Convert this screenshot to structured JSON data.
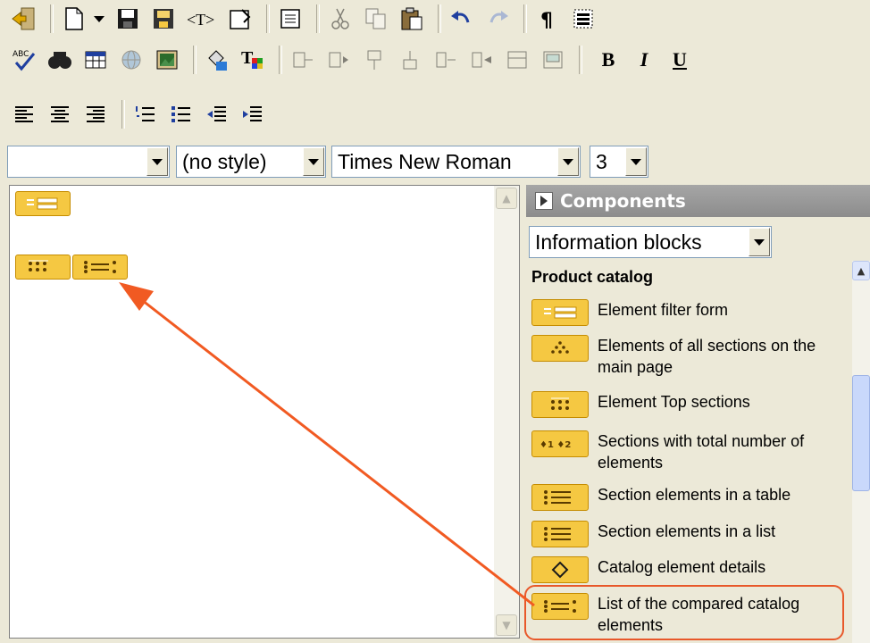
{
  "toolbar": {
    "row1": [
      "exit-icon",
      "new-document-icon",
      "dropdown-arrow-icon",
      "save-icon",
      "save-as-icon",
      "template-icon",
      "properties-icon",
      "html-source-icon",
      "cut-icon",
      "copy-icon",
      "paste-icon",
      "undo-icon",
      "redo-icon",
      "pilcrow-icon",
      "table-borders-icon"
    ],
    "row2": [
      "spellcheck-icon",
      "find-icon",
      "insert-table-icon",
      "insert-link-icon",
      "insert-image-icon",
      "fill-color-icon",
      "text-color-icon",
      "table-ops-icons"
    ],
    "bold_label": "B",
    "italic_label": "I",
    "underline_label": "U"
  },
  "format_bar": {
    "paragraph_value": "",
    "style_value": "(no style)",
    "font_value": "Times New Roman",
    "size_value": "3"
  },
  "components": {
    "title": "Components",
    "category_value": "Information blocks",
    "section_title": "Product catalog",
    "items": [
      {
        "label": "Element filter form",
        "icon": "filter-form-icon"
      },
      {
        "label": "Elements of all sections on the main page",
        "icon": "all-sections-icon"
      },
      {
        "label": "Element Top sections",
        "icon": "top-sections-icon"
      },
      {
        "label": "Sections with total number of elements",
        "icon": "numbered-sections-icon"
      },
      {
        "label": "Section elements in a table",
        "icon": "list-table-icon"
      },
      {
        "label": "Section elements in a list",
        "icon": "list-icon"
      },
      {
        "label": "Catalog element details",
        "icon": "diamond-icon"
      },
      {
        "label": "List of the compared catalog elements",
        "icon": "compare-list-icon"
      }
    ]
  },
  "colors": {
    "accent": "#f5c842",
    "arrow": "#f15a22",
    "highlight_border": "#e8582a"
  }
}
